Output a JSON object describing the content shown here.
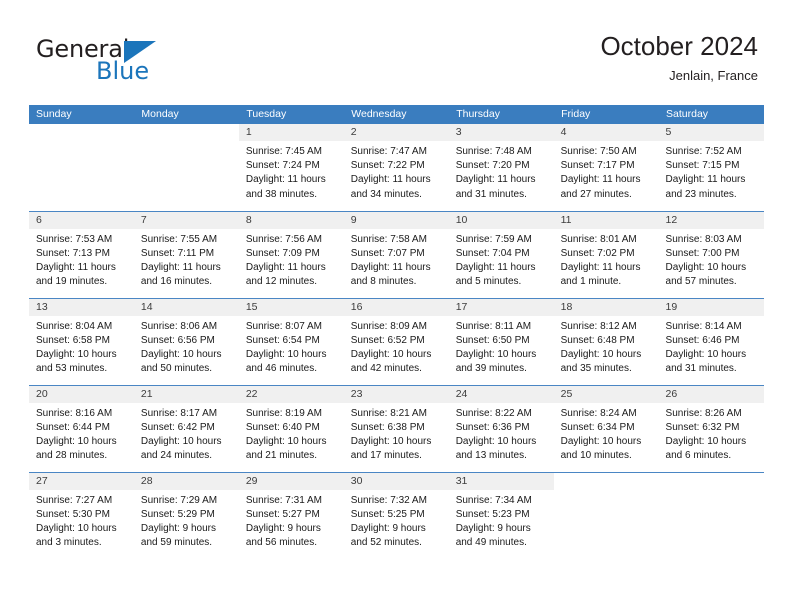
{
  "brand": {
    "name_part1": "General",
    "name_part2": "Blue",
    "triangle_icon": "triangle-icon",
    "color_dark": "#231f20",
    "color_blue": "#1b75bb"
  },
  "header": {
    "title": "October 2024",
    "subtitle": "Jenlain, France",
    "accent_color": "#3a7dbf",
    "datebar_color": "#f0f0f0"
  },
  "weekdays": [
    "Sunday",
    "Monday",
    "Tuesday",
    "Wednesday",
    "Thursday",
    "Friday",
    "Saturday"
  ],
  "labels": {
    "sunrise": "Sunrise:",
    "sunset": "Sunset:",
    "daylight": "Daylight:"
  },
  "weeks": [
    [
      {
        "date": "",
        "empty": true,
        "shaded": false,
        "line1": "",
        "line2": "",
        "line3": "",
        "line4": ""
      },
      {
        "date": "",
        "empty": true,
        "shaded": false,
        "line1": "",
        "line2": "",
        "line3": "",
        "line4": ""
      },
      {
        "date": "1",
        "empty": false,
        "shaded": true,
        "line1": "Sunrise: 7:45 AM",
        "line2": "Sunset: 7:24 PM",
        "line3": "Daylight: 11 hours",
        "line4": "and 38 minutes."
      },
      {
        "date": "2",
        "empty": false,
        "shaded": true,
        "line1": "Sunrise: 7:47 AM",
        "line2": "Sunset: 7:22 PM",
        "line3": "Daylight: 11 hours",
        "line4": "and 34 minutes."
      },
      {
        "date": "3",
        "empty": false,
        "shaded": true,
        "line1": "Sunrise: 7:48 AM",
        "line2": "Sunset: 7:20 PM",
        "line3": "Daylight: 11 hours",
        "line4": "and 31 minutes."
      },
      {
        "date": "4",
        "empty": false,
        "shaded": true,
        "line1": "Sunrise: 7:50 AM",
        "line2": "Sunset: 7:17 PM",
        "line3": "Daylight: 11 hours",
        "line4": "and 27 minutes."
      },
      {
        "date": "5",
        "empty": false,
        "shaded": true,
        "line1": "Sunrise: 7:52 AM",
        "line2": "Sunset: 7:15 PM",
        "line3": "Daylight: 11 hours",
        "line4": "and 23 minutes."
      }
    ],
    [
      {
        "date": "6",
        "empty": false,
        "shaded": true,
        "line1": "Sunrise: 7:53 AM",
        "line2": "Sunset: 7:13 PM",
        "line3": "Daylight: 11 hours",
        "line4": "and 19 minutes."
      },
      {
        "date": "7",
        "empty": false,
        "shaded": true,
        "line1": "Sunrise: 7:55 AM",
        "line2": "Sunset: 7:11 PM",
        "line3": "Daylight: 11 hours",
        "line4": "and 16 minutes."
      },
      {
        "date": "8",
        "empty": false,
        "shaded": true,
        "line1": "Sunrise: 7:56 AM",
        "line2": "Sunset: 7:09 PM",
        "line3": "Daylight: 11 hours",
        "line4": "and 12 minutes."
      },
      {
        "date": "9",
        "empty": false,
        "shaded": true,
        "line1": "Sunrise: 7:58 AM",
        "line2": "Sunset: 7:07 PM",
        "line3": "Daylight: 11 hours",
        "line4": "and 8 minutes."
      },
      {
        "date": "10",
        "empty": false,
        "shaded": true,
        "line1": "Sunrise: 7:59 AM",
        "line2": "Sunset: 7:04 PM",
        "line3": "Daylight: 11 hours",
        "line4": "and 5 minutes."
      },
      {
        "date": "11",
        "empty": false,
        "shaded": true,
        "line1": "Sunrise: 8:01 AM",
        "line2": "Sunset: 7:02 PM",
        "line3": "Daylight: 11 hours",
        "line4": "and 1 minute."
      },
      {
        "date": "12",
        "empty": false,
        "shaded": true,
        "line1": "Sunrise: 8:03 AM",
        "line2": "Sunset: 7:00 PM",
        "line3": "Daylight: 10 hours",
        "line4": "and 57 minutes."
      }
    ],
    [
      {
        "date": "13",
        "empty": false,
        "shaded": true,
        "line1": "Sunrise: 8:04 AM",
        "line2": "Sunset: 6:58 PM",
        "line3": "Daylight: 10 hours",
        "line4": "and 53 minutes."
      },
      {
        "date": "14",
        "empty": false,
        "shaded": true,
        "line1": "Sunrise: 8:06 AM",
        "line2": "Sunset: 6:56 PM",
        "line3": "Daylight: 10 hours",
        "line4": "and 50 minutes."
      },
      {
        "date": "15",
        "empty": false,
        "shaded": true,
        "line1": "Sunrise: 8:07 AM",
        "line2": "Sunset: 6:54 PM",
        "line3": "Daylight: 10 hours",
        "line4": "and 46 minutes."
      },
      {
        "date": "16",
        "empty": false,
        "shaded": true,
        "line1": "Sunrise: 8:09 AM",
        "line2": "Sunset: 6:52 PM",
        "line3": "Daylight: 10 hours",
        "line4": "and 42 minutes."
      },
      {
        "date": "17",
        "empty": false,
        "shaded": true,
        "line1": "Sunrise: 8:11 AM",
        "line2": "Sunset: 6:50 PM",
        "line3": "Daylight: 10 hours",
        "line4": "and 39 minutes."
      },
      {
        "date": "18",
        "empty": false,
        "shaded": true,
        "line1": "Sunrise: 8:12 AM",
        "line2": "Sunset: 6:48 PM",
        "line3": "Daylight: 10 hours",
        "line4": "and 35 minutes."
      },
      {
        "date": "19",
        "empty": false,
        "shaded": true,
        "line1": "Sunrise: 8:14 AM",
        "line2": "Sunset: 6:46 PM",
        "line3": "Daylight: 10 hours",
        "line4": "and 31 minutes."
      }
    ],
    [
      {
        "date": "20",
        "empty": false,
        "shaded": true,
        "line1": "Sunrise: 8:16 AM",
        "line2": "Sunset: 6:44 PM",
        "line3": "Daylight: 10 hours",
        "line4": "and 28 minutes."
      },
      {
        "date": "21",
        "empty": false,
        "shaded": true,
        "line1": "Sunrise: 8:17 AM",
        "line2": "Sunset: 6:42 PM",
        "line3": "Daylight: 10 hours",
        "line4": "and 24 minutes."
      },
      {
        "date": "22",
        "empty": false,
        "shaded": true,
        "line1": "Sunrise: 8:19 AM",
        "line2": "Sunset: 6:40 PM",
        "line3": "Daylight: 10 hours",
        "line4": "and 21 minutes."
      },
      {
        "date": "23",
        "empty": false,
        "shaded": true,
        "line1": "Sunrise: 8:21 AM",
        "line2": "Sunset: 6:38 PM",
        "line3": "Daylight: 10 hours",
        "line4": "and 17 minutes."
      },
      {
        "date": "24",
        "empty": false,
        "shaded": true,
        "line1": "Sunrise: 8:22 AM",
        "line2": "Sunset: 6:36 PM",
        "line3": "Daylight: 10 hours",
        "line4": "and 13 minutes."
      },
      {
        "date": "25",
        "empty": false,
        "shaded": true,
        "line1": "Sunrise: 8:24 AM",
        "line2": "Sunset: 6:34 PM",
        "line3": "Daylight: 10 hours",
        "line4": "and 10 minutes."
      },
      {
        "date": "26",
        "empty": false,
        "shaded": true,
        "line1": "Sunrise: 8:26 AM",
        "line2": "Sunset: 6:32 PM",
        "line3": "Daylight: 10 hours",
        "line4": "and 6 minutes."
      }
    ],
    [
      {
        "date": "27",
        "empty": false,
        "shaded": true,
        "line1": "Sunrise: 7:27 AM",
        "line2": "Sunset: 5:30 PM",
        "line3": "Daylight: 10 hours",
        "line4": "and 3 minutes."
      },
      {
        "date": "28",
        "empty": false,
        "shaded": true,
        "line1": "Sunrise: 7:29 AM",
        "line2": "Sunset: 5:29 PM",
        "line3": "Daylight: 9 hours",
        "line4": "and 59 minutes."
      },
      {
        "date": "29",
        "empty": false,
        "shaded": true,
        "line1": "Sunrise: 7:31 AM",
        "line2": "Sunset: 5:27 PM",
        "line3": "Daylight: 9 hours",
        "line4": "and 56 minutes."
      },
      {
        "date": "30",
        "empty": false,
        "shaded": true,
        "line1": "Sunrise: 7:32 AM",
        "line2": "Sunset: 5:25 PM",
        "line3": "Daylight: 9 hours",
        "line4": "and 52 minutes."
      },
      {
        "date": "31",
        "empty": false,
        "shaded": true,
        "line1": "Sunrise: 7:34 AM",
        "line2": "Sunset: 5:23 PM",
        "line3": "Daylight: 9 hours",
        "line4": "and 49 minutes."
      },
      {
        "date": "",
        "empty": true,
        "shaded": false,
        "line1": "",
        "line2": "",
        "line3": "",
        "line4": ""
      },
      {
        "date": "",
        "empty": true,
        "shaded": false,
        "line1": "",
        "line2": "",
        "line3": "",
        "line4": ""
      }
    ]
  ]
}
